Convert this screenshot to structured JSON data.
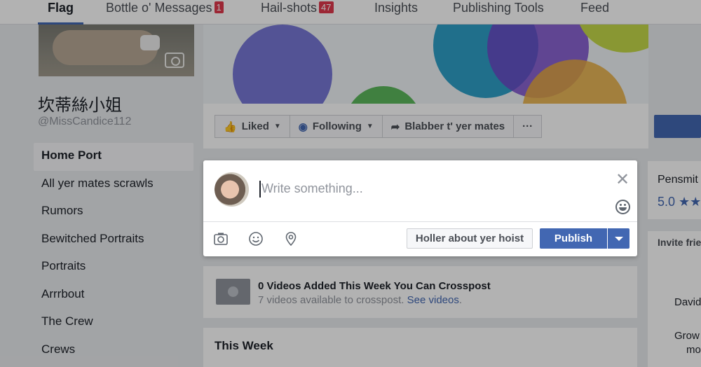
{
  "nav": {
    "tabs": [
      {
        "label": "Flag"
      },
      {
        "label": "Bottle o' Messages",
        "badge": "1"
      },
      {
        "label": "Hail-shots",
        "badge": "47"
      },
      {
        "label": "Insights"
      },
      {
        "label": "Publishing Tools"
      },
      {
        "label": "Feed"
      }
    ]
  },
  "profile": {
    "name": "坎蒂絲小姐",
    "handle": "@MissCandice112"
  },
  "sidebar": {
    "items": [
      {
        "label": "Home Port"
      },
      {
        "label": "All yer mates scrawls"
      },
      {
        "label": "Rumors"
      },
      {
        "label": "Bewitched Portraits"
      },
      {
        "label": "Portraits"
      },
      {
        "label": "Arrrbout"
      },
      {
        "label": "The Crew"
      },
      {
        "label": "Crews"
      }
    ]
  },
  "actions": {
    "liked": "Liked",
    "following": "Following",
    "share": "Blabber t' yer mates",
    "more": "···"
  },
  "composer": {
    "placeholder": "Write something...",
    "close": "✕",
    "holler_label": "Holler about yer hoist",
    "publish_label": "Publish"
  },
  "crosspost": {
    "title": "0 Videos Added This Week You Can Crosspost",
    "subtitle": "7 videos available to crosspost.",
    "link": "See videos",
    "period": "."
  },
  "this_week": {
    "title": "This Week"
  },
  "right": {
    "card_title": "Pensmit",
    "rating": "5.0 ★★",
    "invite_title": "Invite frie",
    "friend1": "David",
    "friend2": "Grow",
    "friend3": "mo"
  },
  "colors": {
    "brand_blue": "#4267b2",
    "badge_red": "#e0394c"
  }
}
